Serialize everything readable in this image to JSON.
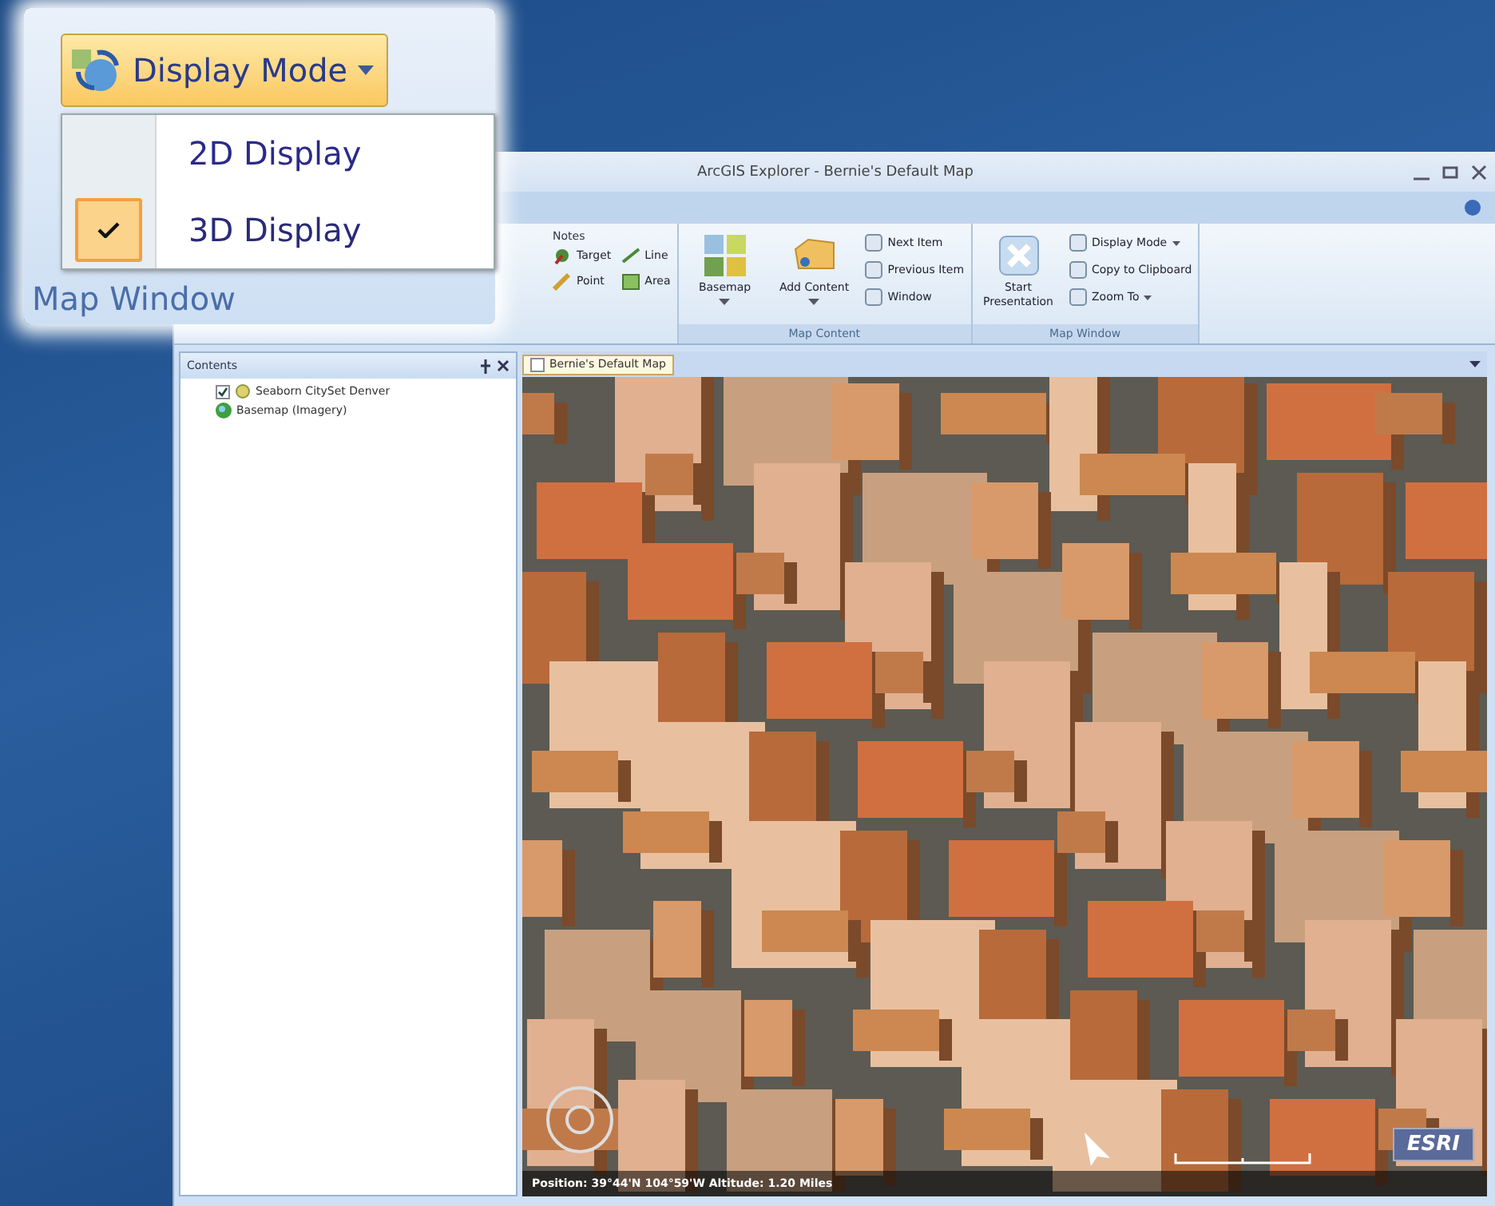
{
  "window": {
    "title": "ArcGIS Explorer - Bernie's Default Map"
  },
  "ribbon": {
    "groups": [
      {
        "kind": "notes",
        "title": "Notes",
        "items": [
          {
            "label": "Target"
          },
          {
            "label": "Line"
          },
          {
            "label": "Point"
          },
          {
            "label": "Area"
          }
        ]
      },
      {
        "kind": "buttons",
        "label": "Map Content",
        "large": [
          {
            "label": "Basemap",
            "dropdown": true
          },
          {
            "label": "Add Content",
            "dropdown": true
          }
        ],
        "small": [
          {
            "label": "Next Item",
            "dropdown": false
          },
          {
            "label": "Previous Item",
            "dropdown": false
          },
          {
            "label": "Window",
            "dropdown": false
          }
        ]
      },
      {
        "kind": "buttons",
        "label": "Map Window",
        "large": [
          {
            "label": "Start Presentation",
            "dropdown": false
          }
        ],
        "small": [
          {
            "label": "Display Mode",
            "dropdown": true
          },
          {
            "label": "Copy to Clipboard",
            "dropdown": false
          },
          {
            "label": "Zoom To",
            "dropdown": true
          }
        ]
      }
    ]
  },
  "contents": {
    "title": "Contents",
    "items": [
      {
        "kind": "layer",
        "label": "Seaborn CitySet Denver",
        "checked": true
      },
      {
        "kind": "basemap",
        "label": "Basemap (Imagery)"
      }
    ]
  },
  "map": {
    "tab": "Bernie's Default Map",
    "logo": "ESRI",
    "status": "Position: 39°44'N 104°59'W  Altitude: 1.20 Miles"
  },
  "callout": {
    "button": "Display Mode",
    "menu": [
      {
        "label": "2D Display",
        "selected": false
      },
      {
        "label": "3D Display",
        "selected": true
      }
    ],
    "group_label": "Map Window"
  }
}
